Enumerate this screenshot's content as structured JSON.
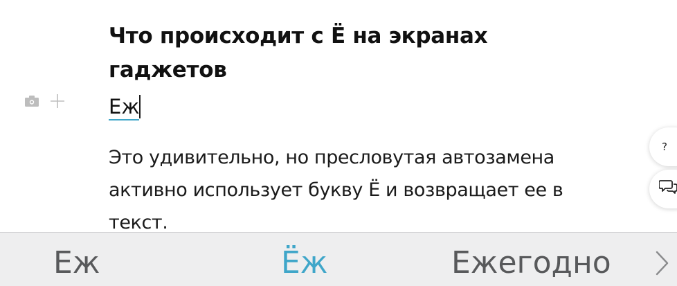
{
  "article": {
    "title": "Что происходит с Ё на экранах гаджетов",
    "typed_word": "Еж",
    "paragraph": "Это удивительно, но пресловутая автозамена активно использует букву Ё и возвращает ее в текст."
  },
  "side_buttons": {
    "help_label": "?"
  },
  "keyboard_suggestions": [
    {
      "label": "Еж"
    },
    {
      "label": "Ёж",
      "highlighted": true
    },
    {
      "label": "Ежегодно"
    }
  ],
  "icons": {
    "block_tools": [
      "camera-icon",
      "plus-icon"
    ],
    "side": [
      "help-icon",
      "chat-icon"
    ],
    "suggestions_more": "chevron-right-icon"
  },
  "colors": {
    "accent": "#3fa6c9",
    "suggestion_text": "#58595b",
    "suggestion_bar_bg": "#eeeeef",
    "text": "#111111"
  }
}
